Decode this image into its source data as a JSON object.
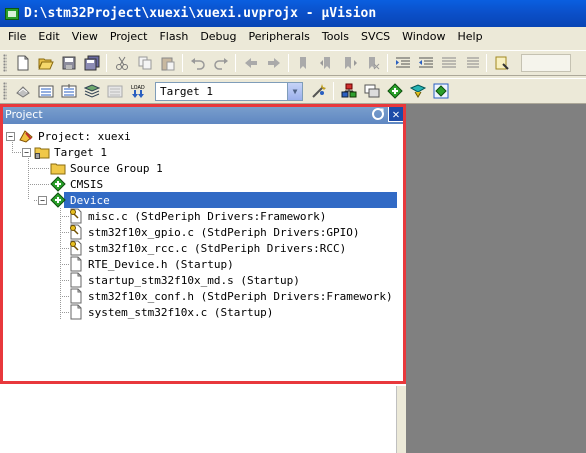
{
  "window": {
    "title": "D:\\stm32Project\\xuexi\\xuexi.uvprojx - µVision"
  },
  "menu": [
    "File",
    "Edit",
    "View",
    "Project",
    "Flash",
    "Debug",
    "Peripherals",
    "Tools",
    "SVCS",
    "Window",
    "Help"
  ],
  "toolbar2": {
    "target": "Target 1"
  },
  "panel": {
    "title": "Project"
  },
  "tree": {
    "project": "Project: xuexi",
    "target": "Target 1",
    "group": "Source Group 1",
    "cmsis": "CMSIS",
    "device": "Device",
    "files": [
      "misc.c (StdPeriph Drivers:Framework)",
      "stm32f10x_gpio.c (StdPeriph Drivers:GPIO)",
      "stm32f10x_rcc.c (StdPeriph Drivers:RCC)",
      "RTE_Device.h (Startup)",
      "startup_stm32f10x_md.s (Startup)",
      "stm32f10x_conf.h (StdPeriph Drivers:Framework)",
      "system_stm32f10x.c (Startup)"
    ]
  },
  "colors": {
    "titlebar": "#0b4fc8",
    "selection": "#316ac5",
    "highlight": "#e8383c",
    "panel_header": "#6b90c8"
  }
}
